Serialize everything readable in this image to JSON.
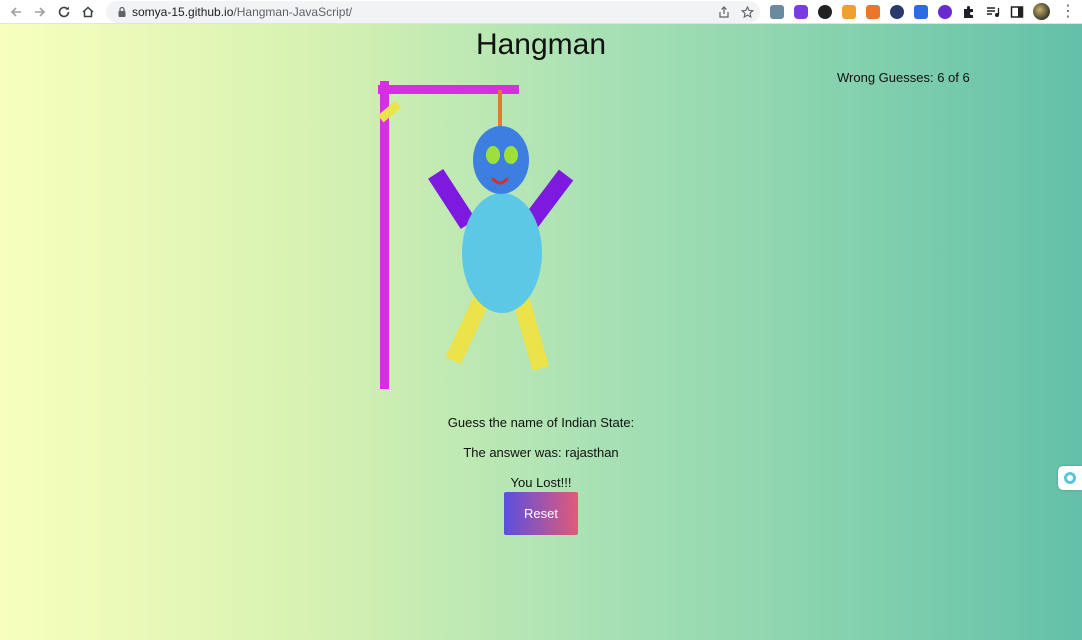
{
  "browser": {
    "url_host": "somya-15.github.io",
    "url_path": "/Hangman-JavaScript/",
    "back_icon": "back-arrow-icon",
    "forward_icon": "forward-arrow-icon",
    "reload_icon": "reload-icon",
    "home_icon": "home-icon"
  },
  "game": {
    "title": "Hangman",
    "wrong_guesses": "Wrong Guesses: 6 of 6",
    "hint": "Guess the name of Indian State:",
    "answer": "The answer was: rajasthan",
    "result": "You Lost!!!",
    "reset_label": "Reset"
  },
  "colors": {
    "gallows": "#d62fe3",
    "rope": "#e07c30",
    "head": "#3c7fe0",
    "eyes": "#9ee03a",
    "mouth": "#d6302b",
    "body": "#5cc8e6",
    "arms": "#7e1ae0",
    "legs": "#ece24a",
    "brace": "#ece24a"
  }
}
